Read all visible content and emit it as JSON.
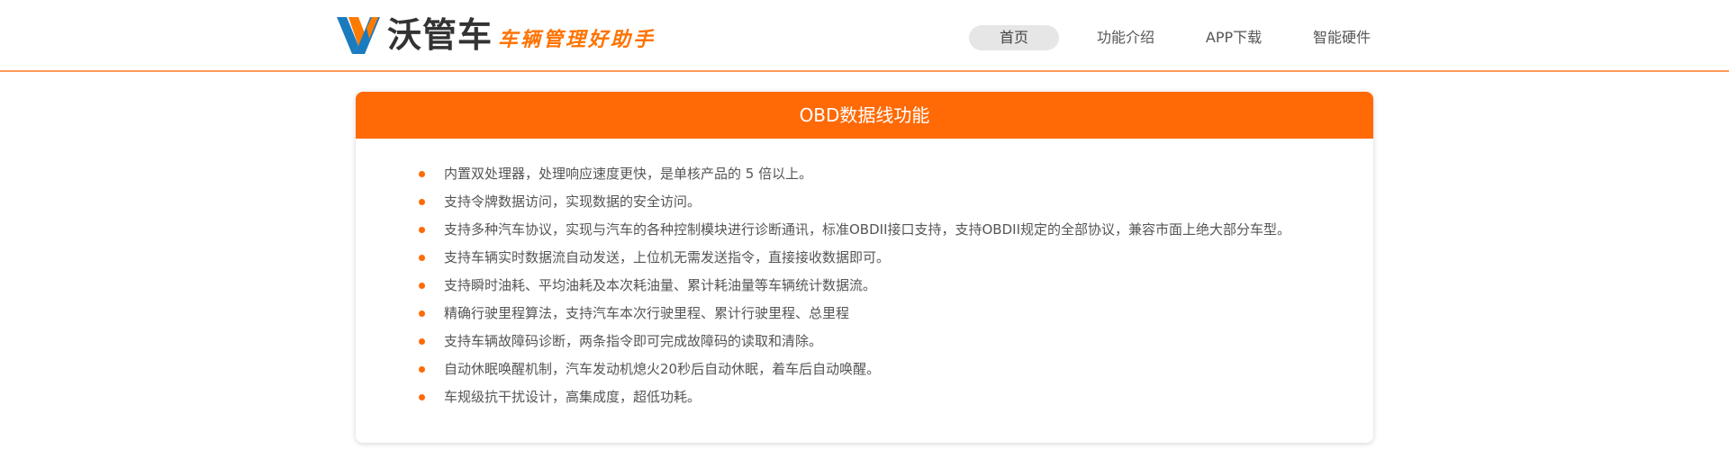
{
  "header": {
    "brand_name": "沃管车",
    "slogan": "车辆管理好助手",
    "nav": [
      {
        "label": "首页",
        "active": true
      },
      {
        "label": "功能介绍",
        "active": false
      },
      {
        "label": "APP下载",
        "active": false
      },
      {
        "label": "智能硬件",
        "active": false
      }
    ]
  },
  "card": {
    "title": "OBD数据线功能",
    "features": [
      "内置双处理器，处理响应速度更快，是单核产品的 5 倍以上。",
      "支持令牌数据访问，实现数据的安全访问。",
      "支持多种汽车协议，实现与汽车的各种控制模块进行诊断通讯，标准OBDII接口支持，支持OBDII规定的全部协议，兼容市面上绝大部分车型。",
      "支持车辆实时数据流自动发送，上位机无需发送指令，直接接收数据即可。",
      "支持瞬时油耗、平均油耗及本次耗油量、累计耗油量等车辆统计数据流。",
      "精确行驶里程算法，支持汽车本次行驶里程、累计行驶里程、总里程",
      "支持车辆故障码诊断，两条指令即可完成故障码的读取和清除。",
      "自动休眠唤醒机制，汽车发动机熄火20秒后自动休眠，着车后自动唤醒。",
      "车规级抗干扰设计，高集成度，超低功耗。"
    ]
  },
  "colors": {
    "accent": "#ff6a06",
    "logo_blue": "#1a7bbf",
    "logo_orange": "#ff7a00"
  }
}
